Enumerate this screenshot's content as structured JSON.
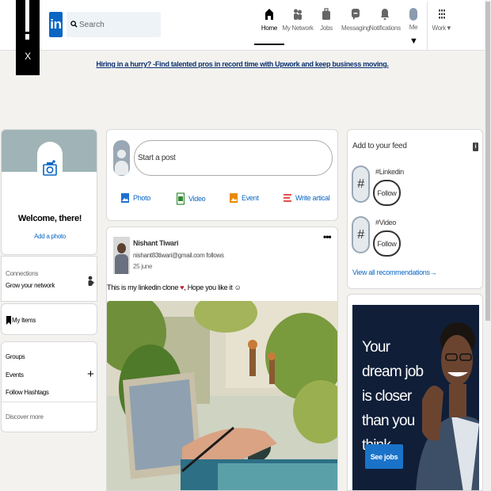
{
  "overlay": {
    "close_label": "X"
  },
  "nav": {
    "logo_text": "in",
    "search_placeholder": "Search",
    "items": [
      {
        "label": "Home",
        "icon": "home-icon",
        "active": true
      },
      {
        "label": "My Network",
        "icon": "network-icon"
      },
      {
        "label": "Jobs",
        "icon": "briefcase-icon"
      },
      {
        "label": "Messaging",
        "icon": "message-icon"
      },
      {
        "label": "Notifications",
        "icon": "bell-icon"
      },
      {
        "label": "Me",
        "icon": "avatar"
      },
      {
        "label": "Work▼",
        "icon": "grid-icon"
      }
    ],
    "me_caret": "▼"
  },
  "promo": {
    "link_text": "Hiring in a hurry? ",
    "text": "-Find talented pros in record time with Upwork and keep business moving."
  },
  "profile": {
    "welcome": "Welcome, there!",
    "add_photo": "Add a photo",
    "connections_title": "Connections",
    "connections_sub": "Grow your network",
    "my_items": "My Items",
    "groups": "Groups",
    "events": "Events",
    "follow_hashtags": "Follow Hashtags",
    "discover_more": "Discover more"
  },
  "share": {
    "start_post": "Start a post",
    "actions": [
      {
        "label": "Photo",
        "icon": "photo-icon",
        "color": "#1f6fd1"
      },
      {
        "label": "Video",
        "icon": "video-icon",
        "color": "#2f8a2f"
      },
      {
        "label": "Event",
        "icon": "event-icon",
        "color": "#e88a00"
      },
      {
        "label": "Write artical",
        "icon": "article-icon",
        "color": "#e0413b"
      }
    ]
  },
  "post": {
    "author": "Nishant Tiwari",
    "subtitle": "nishant83tiwari@gmail.com follows",
    "date": "25 june",
    "more": "•••",
    "text_before": "This is my linkedin clone ",
    "heart": "♥",
    "text_after": ", Hope you like it ",
    "smile": "☺"
  },
  "feed": {
    "title": "Add to your feed",
    "info": "i",
    "hashtags": [
      {
        "name": "#Linkedin",
        "follow": "Follow"
      },
      {
        "name": "#Video",
        "follow": "Follow"
      }
    ],
    "view_all": "View all recommendations"
  },
  "ad": {
    "text": "Your dream job is closer than you think",
    "button": "See jobs"
  }
}
